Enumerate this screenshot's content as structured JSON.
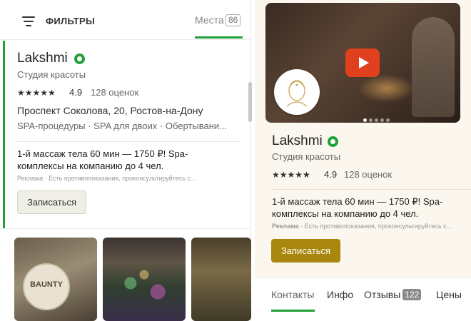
{
  "topbar": {
    "filters_label": "ФИЛЬТРЫ",
    "places_label": "Места",
    "places_count": "86"
  },
  "list_card": {
    "name": "Lakshmi",
    "category": "Студия красоты",
    "stars": "★★★★★",
    "rating": "4.9",
    "reviews": "128 оценок",
    "address": "Проспект Соколова, 20, Ростов-на-Дону",
    "tags": "SPA-процедуры · SPA для двоих · Обертывани...",
    "promo": "1-й массаж тела 60 мин — 1750 ₽! Spa-комплексы на компанию до 4 чел.",
    "ad_label": "Реклама",
    "ad_disclaimer": "· Есть противопоказания, проконсультируйтесь с...",
    "book_label": "Записаться"
  },
  "next_card": {
    "thumb1_text": "BAUNTY"
  },
  "detail": {
    "name": "Lakshmi",
    "category": "Студия красоты",
    "stars": "★★★★★",
    "rating": "4.9",
    "reviews": "128 оценок",
    "promo": "1-й массаж тела 60 мин — 1750 ₽! Spa-комплексы на компанию до 4 чел.",
    "ad_label": "Реклама",
    "ad_disclaimer": "· Есть противопоказания, проконсультируйтесь с...",
    "book_label": "Записаться",
    "tabs": [
      {
        "label": "Контакты"
      },
      {
        "label": "Инфо"
      },
      {
        "label": "Отзывы",
        "badge": "122"
      },
      {
        "label": "Цены"
      }
    ],
    "carousel_slides": 5,
    "carousel_active": 1
  },
  "colors": {
    "accent_green": "#21a038",
    "book_gold": "#a9860d",
    "play_red": "#e0401e"
  },
  "icons": [
    "filter-icon",
    "verified-icon",
    "star-icon",
    "play-icon"
  ]
}
